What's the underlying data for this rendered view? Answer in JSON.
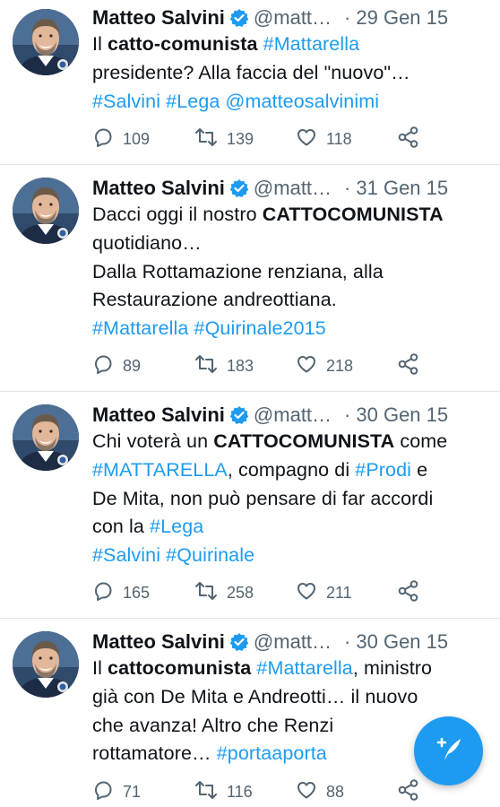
{
  "colors": {
    "accent": "#1d9bf0",
    "muted": "#536471",
    "text": "#0f1419",
    "divider": "#e1e6ea"
  },
  "icons": {
    "reply": "reply-icon",
    "retweet": "retweet-icon",
    "like": "heart-icon",
    "share": "share-icon",
    "verified": "verified-badge-icon",
    "compose": "compose-tweet-icon"
  },
  "tweets": [
    {
      "name": "Matteo Salvini",
      "handle": "@matt…",
      "separator": "·",
      "date": "29 Gen 15",
      "lines": [
        [
          {
            "t": "Il "
          },
          {
            "t": "catto-comunista",
            "s": "bold"
          },
          {
            "t": " "
          },
          {
            "t": "#Mattarella",
            "s": "tag"
          }
        ],
        [
          {
            "t": "presidente? Alla faccia del \"nuovo\"…"
          }
        ],
        [
          {
            "t": "#Salvini",
            "s": "tag"
          },
          {
            "t": " "
          },
          {
            "t": "#Lega",
            "s": "tag"
          },
          {
            "t": " "
          },
          {
            "t": "@matteosalvinimi",
            "s": "tag"
          }
        ]
      ],
      "replies": "109",
      "retweets": "139",
      "likes": "118"
    },
    {
      "name": "Matteo Salvini",
      "handle": "@matt…",
      "separator": "·",
      "date": "31 Gen 15",
      "lines": [
        [
          {
            "t": "Dacci oggi il nostro "
          },
          {
            "t": "CATTOCOMUNISTA",
            "s": "bold"
          }
        ],
        [
          {
            "t": "quotidiano…"
          }
        ],
        [
          {
            "t": "Dalla Rottamazione renziana, alla"
          }
        ],
        [
          {
            "t": "Restaurazione andreottiana."
          }
        ],
        [
          {
            "t": "#Mattarella",
            "s": "tag"
          },
          {
            "t": " "
          },
          {
            "t": "#Quirinale2015",
            "s": "tag"
          }
        ]
      ],
      "replies": "89",
      "retweets": "183",
      "likes": "218"
    },
    {
      "name": "Matteo Salvini",
      "handle": "@matt…",
      "separator": "·",
      "date": "30 Gen 15",
      "lines": [
        [
          {
            "t": "Chi voterà un "
          },
          {
            "t": "CATTOCOMUNISTA",
            "s": "bold"
          },
          {
            "t": " come"
          }
        ],
        [
          {
            "t": "#MATTARELLA",
            "s": "tag"
          },
          {
            "t": ", compagno di "
          },
          {
            "t": "#Prodi",
            "s": "tag"
          },
          {
            "t": " e"
          }
        ],
        [
          {
            "t": "De Mita, non può pensare di far accordi"
          }
        ],
        [
          {
            "t": "con la "
          },
          {
            "t": "#Lega",
            "s": "tag"
          }
        ],
        [
          {
            "t": "#Salvini",
            "s": "tag"
          },
          {
            "t": " "
          },
          {
            "t": "#Quirinale",
            "s": "tag"
          }
        ]
      ],
      "replies": "165",
      "retweets": "258",
      "likes": "211"
    },
    {
      "name": "Matteo Salvini",
      "handle": "@matt…",
      "separator": "·",
      "date": "30 Gen 15",
      "lines": [
        [
          {
            "t": "Il "
          },
          {
            "t": "cattocomunista",
            "s": "bold"
          },
          {
            "t": " "
          },
          {
            "t": "#Mattarella",
            "s": "tag"
          },
          {
            "t": ", ministro"
          }
        ],
        [
          {
            "t": "già con De Mita e Andreotti… il nuovo"
          }
        ],
        [
          {
            "t": "che avanza! Altro che Renzi"
          }
        ],
        [
          {
            "t": "rottamatore… "
          },
          {
            "t": "#portaaporta",
            "s": "tag"
          }
        ]
      ],
      "replies": "71",
      "retweets": "116",
      "likes": "88"
    }
  ]
}
